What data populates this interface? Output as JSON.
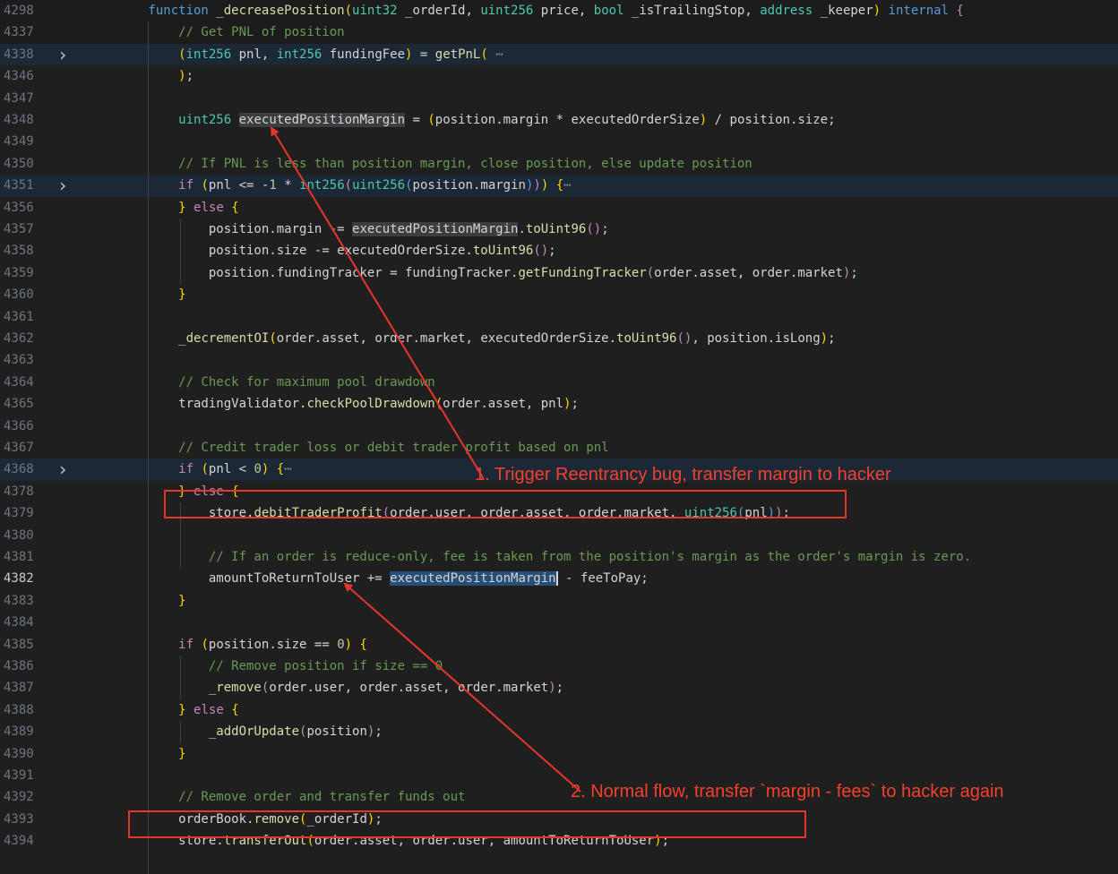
{
  "annotations": {
    "note1": "1. Trigger Reentrancy bug, transfer margin to hacker",
    "note2": "2. Normal flow, transfer `margin -  fees` to hacker again"
  },
  "colors": {
    "background": "#1f1f1f",
    "annotation": "#e8352a",
    "keyword": "#569cd6",
    "function": "#dcdcaa",
    "comment": "#6a9955"
  },
  "editor": {
    "lines": [
      {
        "num": "4298",
        "sticky": true,
        "segs": [
          [
            "k",
            "        function "
          ],
          [
            "f",
            "_decreasePosition"
          ],
          [
            "p",
            "("
          ],
          [
            "t",
            "uint32"
          ],
          [
            "x",
            " _orderId, "
          ],
          [
            "t",
            "uint256"
          ],
          [
            "x",
            " price, "
          ],
          [
            "t",
            "bool"
          ],
          [
            "x",
            " _isTrailingStop, "
          ],
          [
            "t",
            "address"
          ],
          [
            "x",
            " _keeper"
          ],
          [
            "p",
            ")"
          ],
          [
            "x",
            " "
          ],
          [
            "k",
            "internal"
          ],
          [
            "x",
            " "
          ],
          [
            "ctl",
            "{"
          ]
        ]
      },
      {
        "num": "4337",
        "sticky": true,
        "segs": [
          [
            "c",
            "            // Get PNL of position"
          ]
        ]
      },
      {
        "num": "4338",
        "folded": true,
        "segs": [
          [
            "x",
            "            "
          ],
          [
            "p",
            "("
          ],
          [
            "t",
            "int256"
          ],
          [
            "x",
            " pnl, "
          ],
          [
            "t",
            "int256"
          ],
          [
            "x",
            " fundingFee"
          ],
          [
            "p",
            ")"
          ],
          [
            "x",
            " = "
          ],
          [
            "f",
            "getPnL"
          ],
          [
            "p",
            "("
          ],
          [
            "ell",
            " ⋯"
          ]
        ]
      },
      {
        "num": "4346",
        "segs": [
          [
            "x",
            "            "
          ],
          [
            "p",
            ")"
          ],
          [
            "x",
            ";"
          ]
        ]
      },
      {
        "num": "4347",
        "segs": []
      },
      {
        "num": "4348",
        "segs": [
          [
            "x",
            "            "
          ],
          [
            "t",
            "uint256"
          ],
          [
            "x",
            " "
          ],
          [
            "hl",
            "executedPositionMargin"
          ],
          [
            "x",
            " = "
          ],
          [
            "p",
            "("
          ],
          [
            "x",
            "position.margin * executedOrderSize"
          ],
          [
            "p",
            ")"
          ],
          [
            "x",
            " / position.size;"
          ]
        ]
      },
      {
        "num": "4349",
        "segs": []
      },
      {
        "num": "4350",
        "segs": [
          [
            "c",
            "            // If PNL is less than position margin, close position, else update position"
          ]
        ]
      },
      {
        "num": "4351",
        "folded": true,
        "segs": [
          [
            "x",
            "            "
          ],
          [
            "ctl",
            "if"
          ],
          [
            "x",
            " "
          ],
          [
            "p",
            "("
          ],
          [
            "x",
            "pnl <= -"
          ],
          [
            "n",
            "1"
          ],
          [
            "x",
            " * "
          ],
          [
            "t",
            "int256"
          ],
          [
            "ctl",
            "("
          ],
          [
            "t",
            "uint256"
          ],
          [
            "k",
            "("
          ],
          [
            "x",
            "position.margin"
          ],
          [
            "k",
            ")"
          ],
          [
            "ctl",
            ")"
          ],
          [
            "p",
            ")"
          ],
          [
            "x",
            " "
          ],
          [
            "p",
            "{"
          ],
          [
            "ell",
            "⋯"
          ]
        ]
      },
      {
        "num": "4356",
        "segs": [
          [
            "x",
            "            "
          ],
          [
            "p",
            "}"
          ],
          [
            "x",
            " "
          ],
          [
            "ctl",
            "else"
          ],
          [
            "x",
            " "
          ],
          [
            "p",
            "{"
          ]
        ]
      },
      {
        "num": "4357",
        "segs": [
          [
            "x",
            "                position.margin -= "
          ],
          [
            "hl",
            "executedPositionMargin"
          ],
          [
            "x",
            "."
          ],
          [
            "f",
            "toUint96"
          ],
          [
            "ctl",
            "()"
          ],
          [
            "x",
            ";"
          ]
        ]
      },
      {
        "num": "4358",
        "segs": [
          [
            "x",
            "                position.size -= executedOrderSize."
          ],
          [
            "f",
            "toUint96"
          ],
          [
            "ctl",
            "()"
          ],
          [
            "x",
            ";"
          ]
        ]
      },
      {
        "num": "4359",
        "segs": [
          [
            "x",
            "                position.fundingTracker = fundingTracker."
          ],
          [
            "f",
            "getFundingTracker"
          ],
          [
            "ctl",
            "("
          ],
          [
            "x",
            "order.asset, order.market"
          ],
          [
            "ctl",
            ")"
          ],
          [
            "x",
            ";"
          ]
        ]
      },
      {
        "num": "4360",
        "segs": [
          [
            "x",
            "            "
          ],
          [
            "p",
            "}"
          ]
        ]
      },
      {
        "num": "4361",
        "segs": []
      },
      {
        "num": "4362",
        "segs": [
          [
            "x",
            "            "
          ],
          [
            "f",
            "_decrementOI"
          ],
          [
            "p",
            "("
          ],
          [
            "x",
            "order.asset, order.market, executedOrderSize."
          ],
          [
            "f",
            "toUint96"
          ],
          [
            "ctl",
            "()"
          ],
          [
            "x",
            ", position.isLong"
          ],
          [
            "p",
            ")"
          ],
          [
            "x",
            ";"
          ]
        ]
      },
      {
        "num": "4363",
        "segs": []
      },
      {
        "num": "4364",
        "segs": [
          [
            "c",
            "            // Check for maximum pool drawdown"
          ]
        ]
      },
      {
        "num": "4365",
        "segs": [
          [
            "x",
            "            tradingValidator."
          ],
          [
            "f",
            "checkPoolDrawdown"
          ],
          [
            "p",
            "("
          ],
          [
            "x",
            "order.asset, pnl"
          ],
          [
            "p",
            ")"
          ],
          [
            "x",
            ";"
          ]
        ]
      },
      {
        "num": "4366",
        "segs": []
      },
      {
        "num": "4367",
        "segs": [
          [
            "c",
            "            // Credit trader loss or debit trader profit based on pnl"
          ]
        ]
      },
      {
        "num": "4368",
        "folded": true,
        "segs": [
          [
            "x",
            "            "
          ],
          [
            "ctl",
            "if"
          ],
          [
            "x",
            " "
          ],
          [
            "p",
            "("
          ],
          [
            "x",
            "pnl < "
          ],
          [
            "n",
            "0"
          ],
          [
            "p",
            ")"
          ],
          [
            "x",
            " "
          ],
          [
            "p",
            "{"
          ],
          [
            "ell",
            "⋯"
          ]
        ]
      },
      {
        "num": "4378",
        "segs": [
          [
            "x",
            "            "
          ],
          [
            "p",
            "}"
          ],
          [
            "x",
            " "
          ],
          [
            "ctl",
            "else"
          ],
          [
            "x",
            " "
          ],
          [
            "p",
            "{"
          ]
        ]
      },
      {
        "num": "4379",
        "segs": [
          [
            "x",
            "                store."
          ],
          [
            "f",
            "debitTraderProfit"
          ],
          [
            "ctl",
            "("
          ],
          [
            "x",
            "order.user, order.asset, order.market, "
          ],
          [
            "t",
            "uint256"
          ],
          [
            "k",
            "("
          ],
          [
            "x",
            "pnl"
          ],
          [
            "k",
            ")"
          ],
          [
            "ctl",
            ")"
          ],
          [
            "x",
            ";"
          ]
        ]
      },
      {
        "num": "4380",
        "segs": []
      },
      {
        "num": "4381",
        "segs": [
          [
            "c",
            "                // If an order is reduce-only, fee is taken from the position's margin as the order's margin is zero."
          ]
        ]
      },
      {
        "num": "4382",
        "active": true,
        "segs": [
          [
            "x",
            "                amountToReturnToUser += "
          ],
          [
            "sel",
            "executedPositionMargin"
          ],
          [
            "cursor",
            ""
          ],
          [
            "x",
            " - feeToPay;"
          ]
        ]
      },
      {
        "num": "4383",
        "segs": [
          [
            "x",
            "            "
          ],
          [
            "p",
            "}"
          ]
        ]
      },
      {
        "num": "4384",
        "segs": []
      },
      {
        "num": "4385",
        "segs": [
          [
            "x",
            "            "
          ],
          [
            "ctl",
            "if"
          ],
          [
            "x",
            " "
          ],
          [
            "p",
            "("
          ],
          [
            "x",
            "position.size == "
          ],
          [
            "n",
            "0"
          ],
          [
            "p",
            ")"
          ],
          [
            "x",
            " "
          ],
          [
            "p",
            "{"
          ]
        ]
      },
      {
        "num": "4386",
        "segs": [
          [
            "c",
            "                // Remove position if size == 0"
          ]
        ]
      },
      {
        "num": "4387",
        "segs": [
          [
            "x",
            "                "
          ],
          [
            "f",
            "_remove"
          ],
          [
            "ctl",
            "("
          ],
          [
            "x",
            "order.user, order.asset, order.market"
          ],
          [
            "ctl",
            ")"
          ],
          [
            "x",
            ";"
          ]
        ]
      },
      {
        "num": "4388",
        "segs": [
          [
            "x",
            "            "
          ],
          [
            "p",
            "}"
          ],
          [
            "x",
            " "
          ],
          [
            "ctl",
            "else"
          ],
          [
            "x",
            " "
          ],
          [
            "p",
            "{"
          ]
        ]
      },
      {
        "num": "4389",
        "segs": [
          [
            "x",
            "                "
          ],
          [
            "f",
            "_addOrUpdate"
          ],
          [
            "ctl",
            "("
          ],
          [
            "x",
            "position"
          ],
          [
            "ctl",
            ")"
          ],
          [
            "x",
            ";"
          ]
        ]
      },
      {
        "num": "4390",
        "segs": [
          [
            "x",
            "            "
          ],
          [
            "p",
            "}"
          ]
        ]
      },
      {
        "num": "4391",
        "segs": []
      },
      {
        "num": "4392",
        "segs": [
          [
            "c",
            "            // Remove order and transfer funds out"
          ]
        ]
      },
      {
        "num": "4393",
        "segs": [
          [
            "x",
            "            orderBook."
          ],
          [
            "f",
            "remove"
          ],
          [
            "p",
            "("
          ],
          [
            "x",
            "_orderId"
          ],
          [
            "p",
            ")"
          ],
          [
            "x",
            ";"
          ]
        ]
      },
      {
        "num": "4394",
        "segs": [
          [
            "x",
            "            store."
          ],
          [
            "f",
            "transferOut"
          ],
          [
            "p",
            "("
          ],
          [
            "x",
            "order.asset, order.user, amountToReturnToUser"
          ],
          [
            "p",
            ")"
          ],
          [
            "x",
            ";"
          ]
        ]
      }
    ]
  }
}
